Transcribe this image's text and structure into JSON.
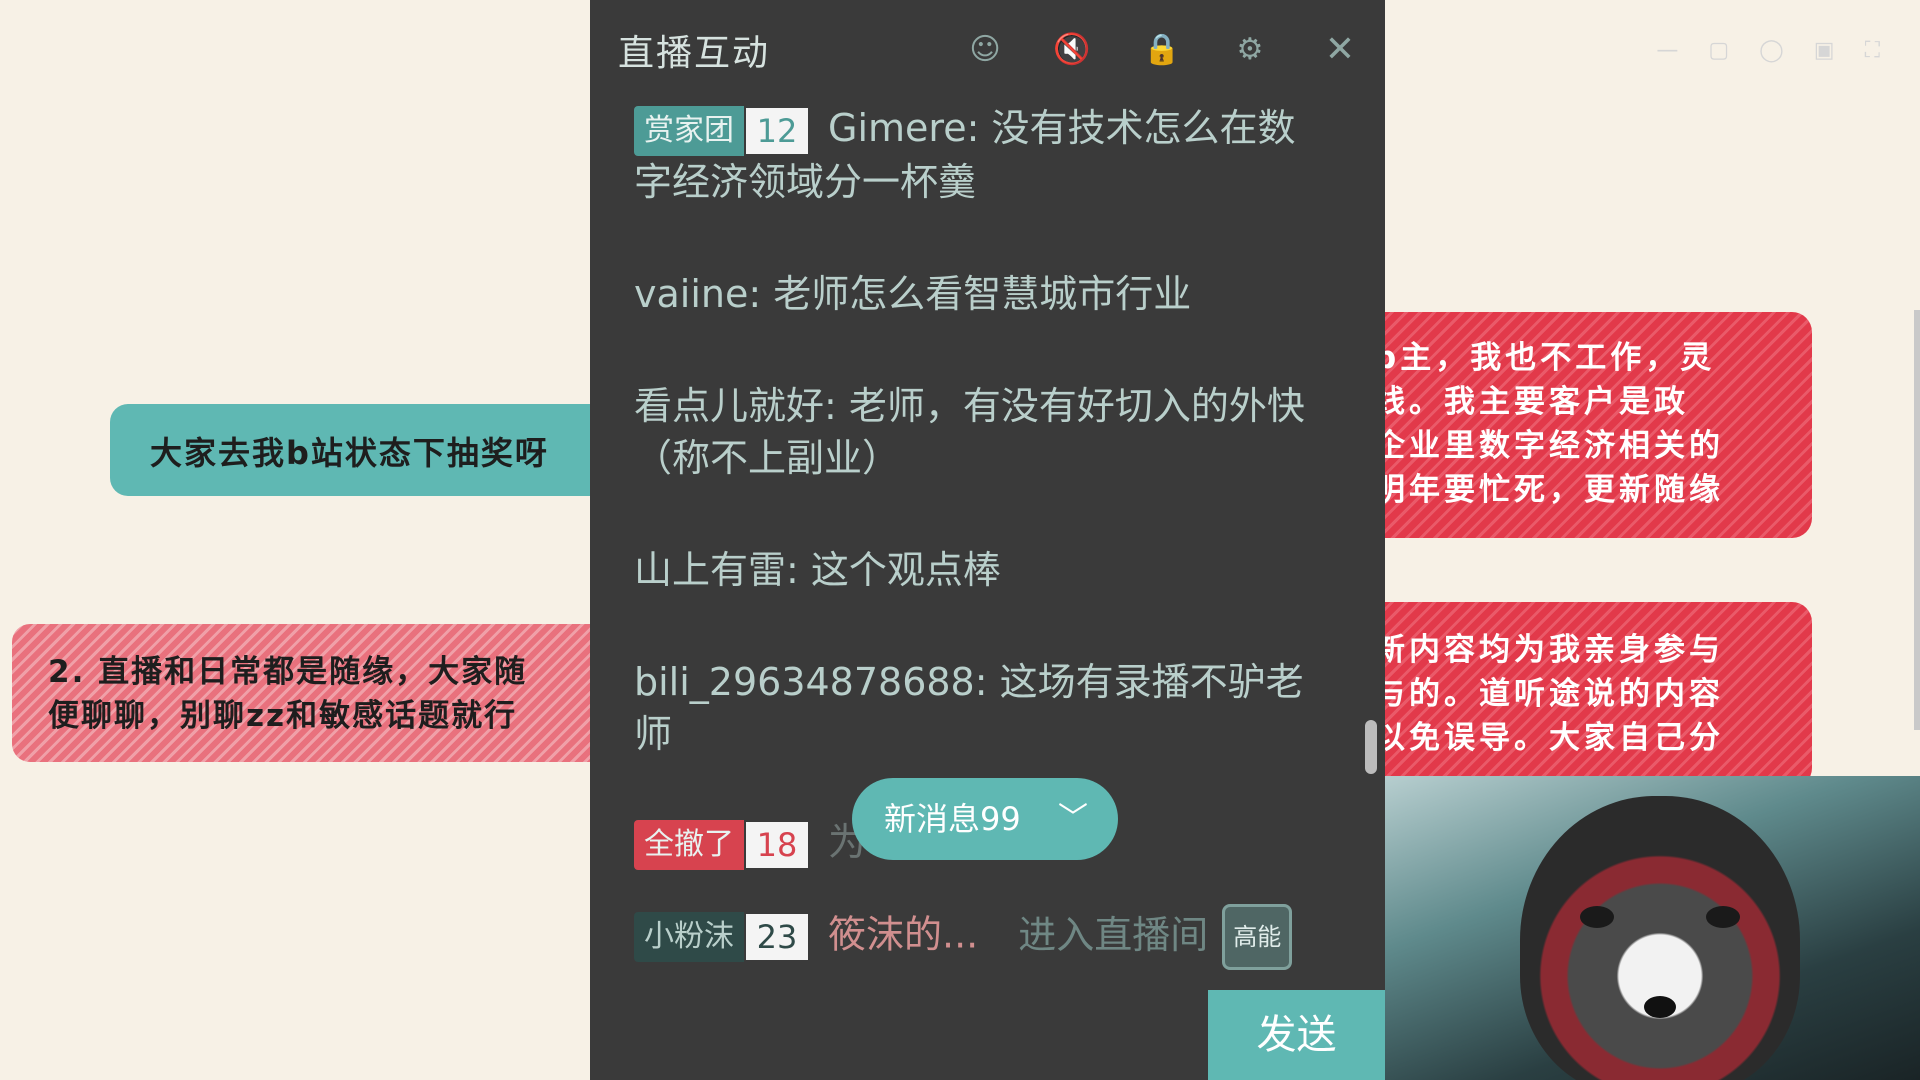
{
  "background": {
    "sticker_teal": "大家去我b站状态下抽奖呀",
    "sticker_pink": [
      "2. 直播和日常都是随缘，大家随",
      "便聊聊，别聊zz和敏感话题就行"
    ],
    "sticker_red_1": [
      "p主，我也不工作，灵",
      "线。我主要客户是政",
      "企业里数字经济相关的",
      "明年要忙死，更新随缘"
    ],
    "sticker_red_2": [
      "新内容均为我亲身参与",
      "与的。道听途说的内容",
      "以免误导。大家自己分"
    ],
    "colors": {
      "teal": "#5fb8b3",
      "pink": "#e9717d",
      "red": "#e2394a",
      "cream": "#f7f1e6"
    }
  },
  "panel": {
    "title": "直播互动",
    "header_icons": [
      "emoji-icon",
      "volume-icon",
      "lock-icon",
      "settings-icon",
      "close-icon"
    ],
    "messages": [
      {
        "badge": {
          "name": "赏家团",
          "level": "12",
          "style": "teal"
        },
        "user": "Gimere",
        "text": "没有技术怎么在数字经济领域分一杯羹"
      },
      {
        "user": "vaiine",
        "text": "老师怎么看智慧城市行业"
      },
      {
        "user": "看点儿就好",
        "text": "老师，有没有好切入的外快（称不上副业）"
      },
      {
        "user": "山上有雷",
        "text": "这个观点棒"
      },
      {
        "user": "bili_29634878688",
        "text": "这场有录播不驴老师"
      }
    ],
    "faded_message": {
      "badge": {
        "name": "全撤了",
        "level": "18",
        "style": "red"
      },
      "text": "为 ... 直播间"
    },
    "enter_message": {
      "badge": {
        "name": "小粉沫",
        "level": "23",
        "style": "dark"
      },
      "name": "筱沫的...",
      "text": "进入直播间",
      "tag": "高能"
    },
    "new_message_pill": "新消息99",
    "send_button": "发送"
  }
}
